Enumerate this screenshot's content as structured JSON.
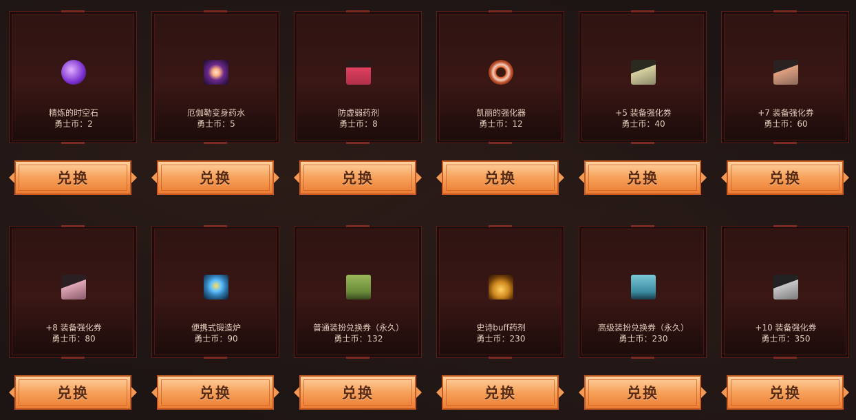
{
  "button_label": "兑换",
  "items": [
    {
      "name": "精炼的时空石",
      "price": "勇士币：2",
      "icon": "time-stone-icon",
      "color": "#7b2fd0"
    },
    {
      "name": "厄伽勒变身药水",
      "price": "勇士币：5",
      "icon": "eye-potion-icon",
      "color": "#6a2a8c"
    },
    {
      "name": "防虚弱药剂",
      "price": "勇士币：8",
      "icon": "flask-icon",
      "color": "#b0304a"
    },
    {
      "name": "凯丽的强化器",
      "price": "勇士币：12",
      "icon": "enhancer-gear-icon",
      "color": "#c0502a"
    },
    {
      "name": "+5 装备强化券",
      "price": "勇士币：40",
      "icon": "ticket-plus5-icon",
      "color": "#8a8a6a"
    },
    {
      "name": "+7 装备强化券",
      "price": "勇士币：60",
      "icon": "ticket-plus7-icon",
      "color": "#8a6a5a"
    },
    {
      "name": "+8 装备强化券",
      "price": "勇士币：80",
      "icon": "ticket-plus8-icon",
      "color": "#8a5a6a"
    },
    {
      "name": "便携式锻造炉",
      "price": "勇士币：90",
      "icon": "forge-icon",
      "color": "#2f7ab0"
    },
    {
      "name": "普通装扮兑换券（永久）",
      "price": "勇士币：132",
      "icon": "avatar-ticket-icon",
      "color": "#6a8a3a"
    },
    {
      "name": "史诗buff药剂",
      "price": "勇士币：230",
      "icon": "epic-potion-icon",
      "color": "#d08a20"
    },
    {
      "name": "高级装扮兑换券（永久）",
      "price": "勇士币：230",
      "icon": "premium-avatar-ticket-icon",
      "color": "#3a8aa0"
    },
    {
      "name": "+10 装备强化券",
      "price": "勇士币：350",
      "icon": "ticket-plus10-icon",
      "color": "#7a7a7a"
    }
  ]
}
